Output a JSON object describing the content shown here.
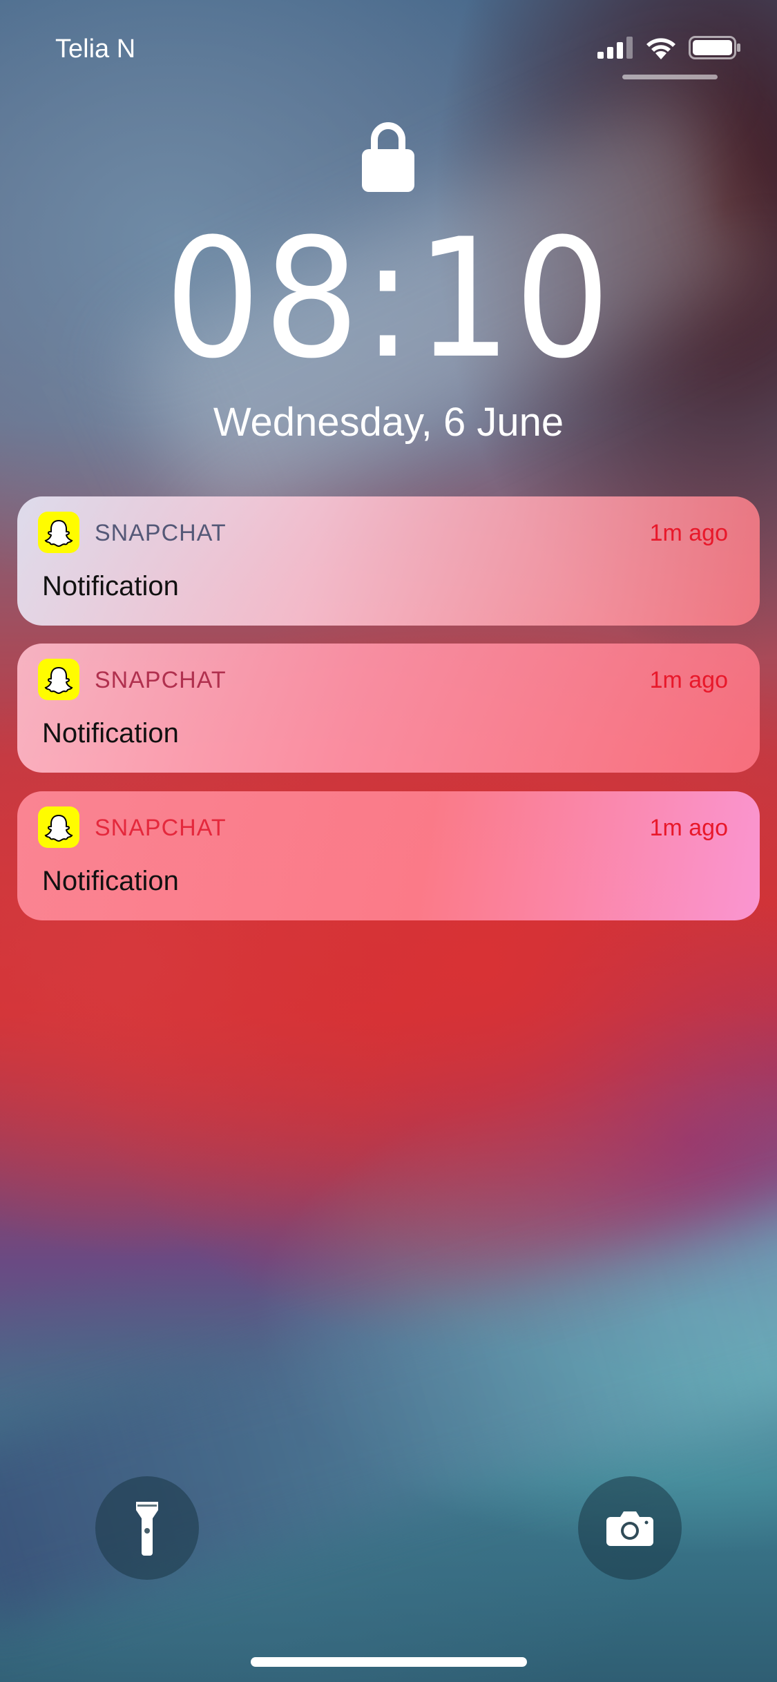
{
  "status_bar": {
    "carrier": "Telia N",
    "signal_icon": "cellular-signal-icon",
    "wifi_icon": "wifi-icon",
    "battery_icon": "battery-icon"
  },
  "lock_screen": {
    "lock_icon": "padlock-icon",
    "time": "08:10",
    "date": "Wednesday, 6 June"
  },
  "notifications": [
    {
      "app": "SNAPCHAT",
      "time_ago": "1m ago",
      "body": "Notification",
      "icon": "snapchat-ghost-icon"
    },
    {
      "app": "SNAPCHAT",
      "time_ago": "1m ago",
      "body": "Notification",
      "icon": "snapchat-ghost-icon"
    },
    {
      "app": "SNAPCHAT",
      "time_ago": "1m ago",
      "body": "Notification",
      "icon": "snapchat-ghost-icon"
    }
  ],
  "quick_actions": {
    "flashlight_icon": "flashlight-icon",
    "camera_icon": "camera-icon"
  },
  "colors": {
    "snapchat_yellow": "#fffc00",
    "timestamp_red": "#e8182a"
  }
}
